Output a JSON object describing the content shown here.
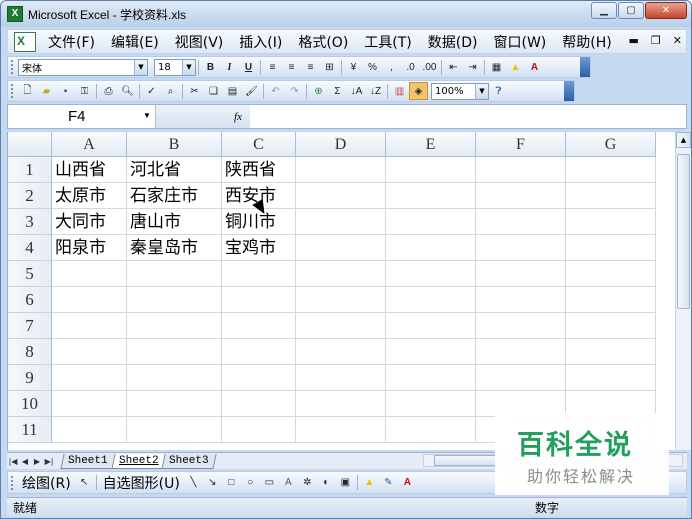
{
  "window": {
    "title": "Microsoft Excel - 学校资料.xls"
  },
  "menu": [
    "文件(F)",
    "编辑(E)",
    "视图(V)",
    "插入(I)",
    "格式(O)",
    "工具(T)",
    "数据(D)",
    "窗口(W)",
    "帮助(H)"
  ],
  "format_toolbar": {
    "font": "宋体",
    "size": "18",
    "percent": "%"
  },
  "standard_toolbar": {
    "zoom": "100%",
    "sigma": "Σ"
  },
  "name_box": "F4",
  "fx": "fx",
  "columns": [
    "A",
    "B",
    "C",
    "D",
    "E",
    "F",
    "G"
  ],
  "rows": [
    "1",
    "2",
    "3",
    "4",
    "5",
    "6",
    "7",
    "8",
    "9",
    "10",
    "11"
  ],
  "cells": [
    [
      "山西省",
      "河北省",
      "陕西省"
    ],
    [
      "太原市",
      "石家庄市",
      "西安市"
    ],
    [
      "大同市",
      "唐山市",
      "铜川市"
    ],
    [
      "阳泉市",
      "秦皇岛市",
      "宝鸡市"
    ]
  ],
  "sheets": [
    "Sheet1",
    "Sheet2",
    "Sheet3"
  ],
  "active_sheet": 1,
  "drawing_toolbar": {
    "draw": "绘图(R)",
    "autoshapes": "自选图形(U)"
  },
  "status": {
    "left": "就绪",
    "right": "数字"
  },
  "watermark": {
    "title": "百科全说",
    "subtitle": "助你轻松解决"
  }
}
